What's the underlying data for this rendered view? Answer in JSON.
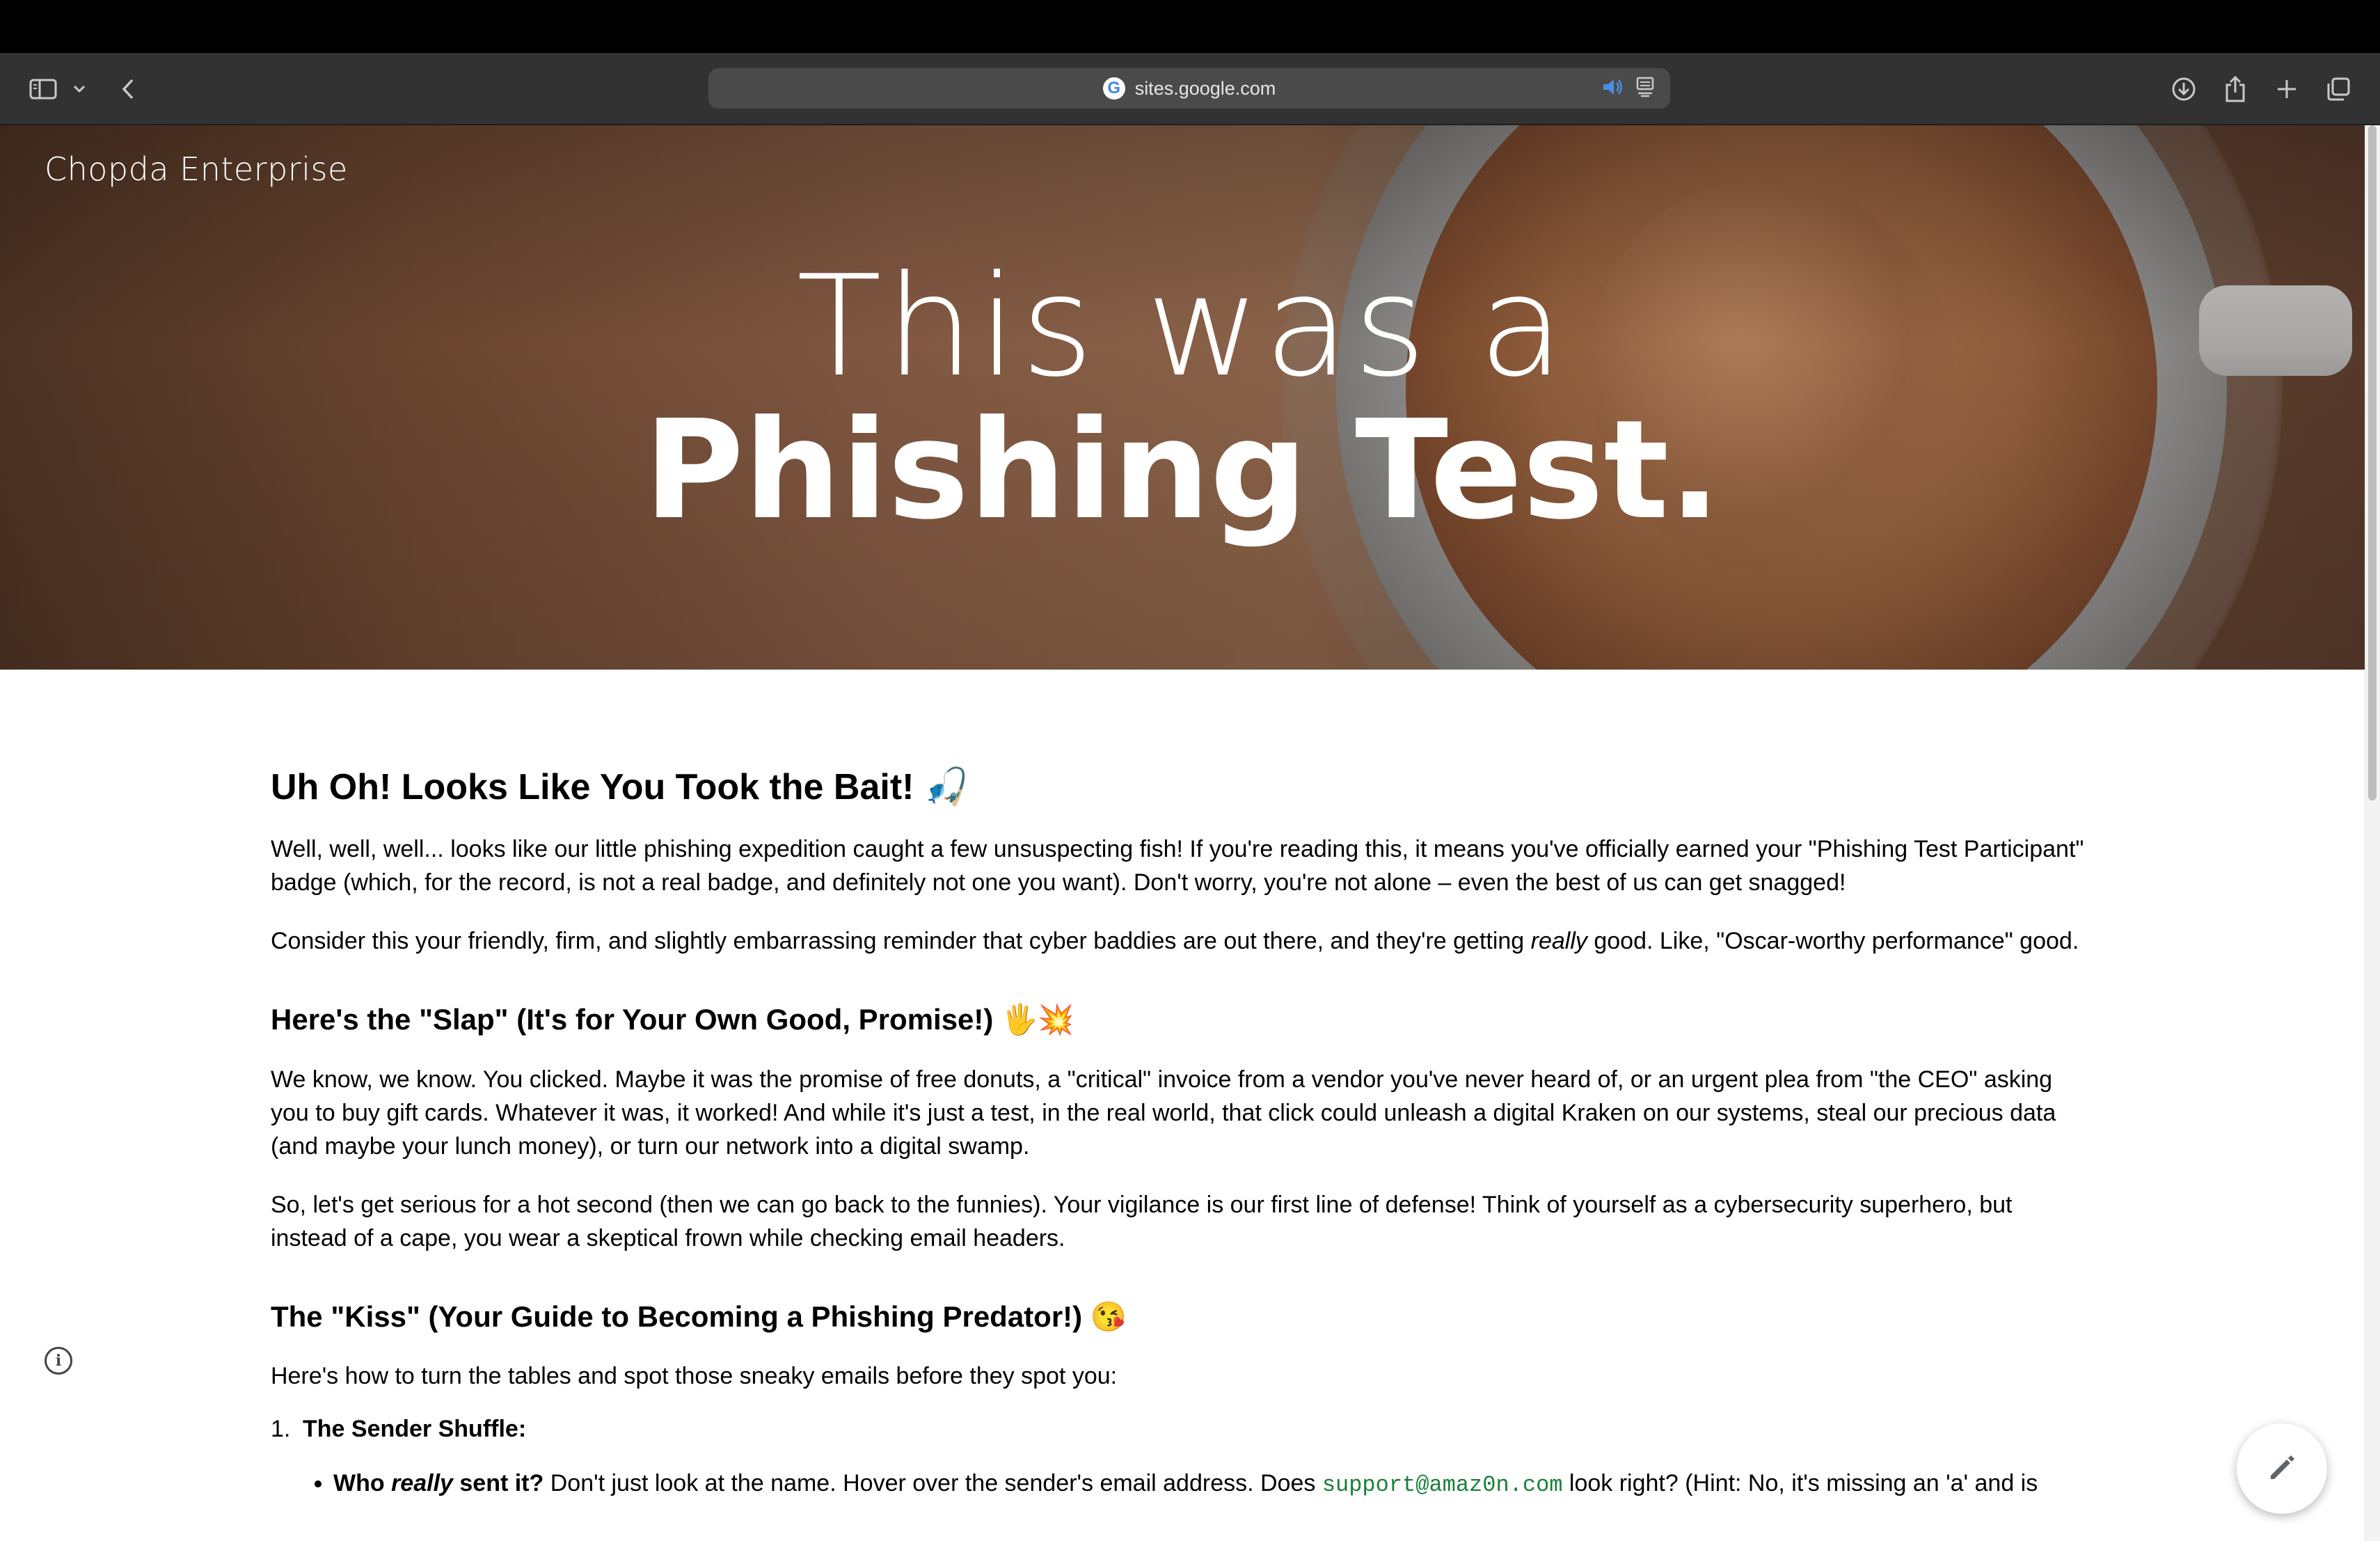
{
  "browser": {
    "url": "sites.google.com",
    "google_mark": "G"
  },
  "site": {
    "name": "Chopda Enterprise",
    "hero_line1": "This was a",
    "hero_line2": "Phishing Test."
  },
  "content": {
    "h1": "Uh Oh! Looks Like You Took the Bait! 🎣",
    "intro_p1": "Well, well, well... looks like our little phishing expedition caught a few unsuspecting fish! If you're reading this, it means you've officially earned your \"Phishing Test Participant\" badge (which, for the record, is not a real badge, and definitely not one you want). Don't worry, you're not alone – even the best of us can get snagged!",
    "intro_p2_before": "Consider this your friendly, firm, and slightly embarrassing reminder that cyber baddies are out there, and they're getting ",
    "intro_p2_em": "really",
    "intro_p2_after": " good. Like, \"Oscar-worthy performance\" good.",
    "h2_slap": "Here's the \"Slap\" (It's for Your Own Good, Promise!) 🖐️💥",
    "slap_p1": "We know, we know. You clicked. Maybe it was the promise of free donuts, a \"critical\" invoice from a vendor you've never heard of, or an urgent plea from \"the CEO\" asking you to buy gift cards. Whatever it was, it worked! And while it's just a test, in the real world, that click could unleash a digital Kraken on our systems, steal our precious data (and maybe your lunch money), or turn our network into a digital swamp.",
    "slap_p2": "So, let's get serious for a hot second (then we can go back to the funnies). Your vigilance is our first line of defense! Think of yourself as a cybersecurity superhero, but instead of a cape, you wear a skeptical frown while checking email headers.",
    "h2_kiss": "The \"Kiss\" (Your Guide to Becoming a Phishing Predator!) 😘",
    "kiss_p1": "Here's how to turn the tables and spot those sneaky emails before they spot you:",
    "list": [
      {
        "num": "1.",
        "title": "The Sender Shuffle:",
        "sub": {
          "bold_before": "Who ",
          "bold_em": "really",
          "bold_after": " sent it?",
          "text": " Don't just look at the name. Hover over the sender's email address. Does ",
          "code": "support@amaz0n.com",
          "text_after": " look right? (Hint: No, it's missing an 'a' and is"
        }
      }
    ]
  },
  "colors": {
    "toolbar_bg": "#323232",
    "urlbar_bg": "#4a4a4a",
    "code_green": "#188038"
  },
  "icons": [
    "sidebar-icon",
    "chevron-down-icon",
    "back-icon",
    "google-icon",
    "speaker-icon",
    "reader-icon",
    "download-icon",
    "share-icon",
    "plus-icon",
    "tabs-icon",
    "info-icon",
    "pencil-icon"
  ]
}
